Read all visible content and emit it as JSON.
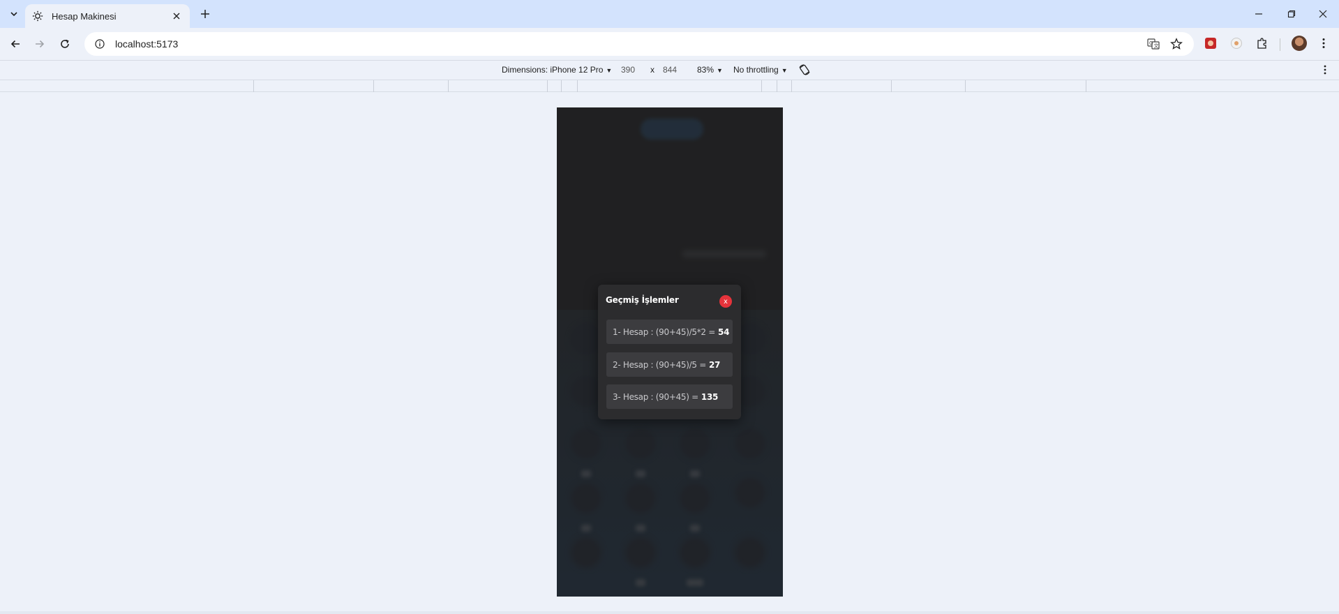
{
  "browser": {
    "tab_title": "Hesap Makinesi",
    "url": "localhost:5173"
  },
  "device_toolbar": {
    "dimensions_label": "Dimensions: iPhone 12 Pro",
    "width": "390",
    "times": "x",
    "height": "844",
    "zoom": "83%",
    "throttling": "No throttling"
  },
  "history_modal": {
    "title": "Geçmiş İşlemler",
    "close_label": "x",
    "items": [
      {
        "text": "1- Hesap : (90+45)/5*2 =",
        "result": "54"
      },
      {
        "text": "2- Hesap : (90+45)/5 =",
        "result": "27"
      },
      {
        "text": "3- Hesap : (90+45) =",
        "result": "135"
      }
    ]
  },
  "icons": {
    "tab_search": "chevron-down-icon",
    "favicon": "sun-icon",
    "back": "arrow-left-icon",
    "forward": "arrow-right-icon",
    "reload": "reload-icon",
    "site_info": "info-icon",
    "translate": "translate-icon",
    "bookmark": "star-icon",
    "extensions": "puzzle-icon",
    "menu": "kebab-menu-icon",
    "rotate": "rotate-icon"
  },
  "colors": {
    "close_button": "#e5333b",
    "modal_bg": "#2c2c2e",
    "item_bg": "#3c3c3f"
  }
}
